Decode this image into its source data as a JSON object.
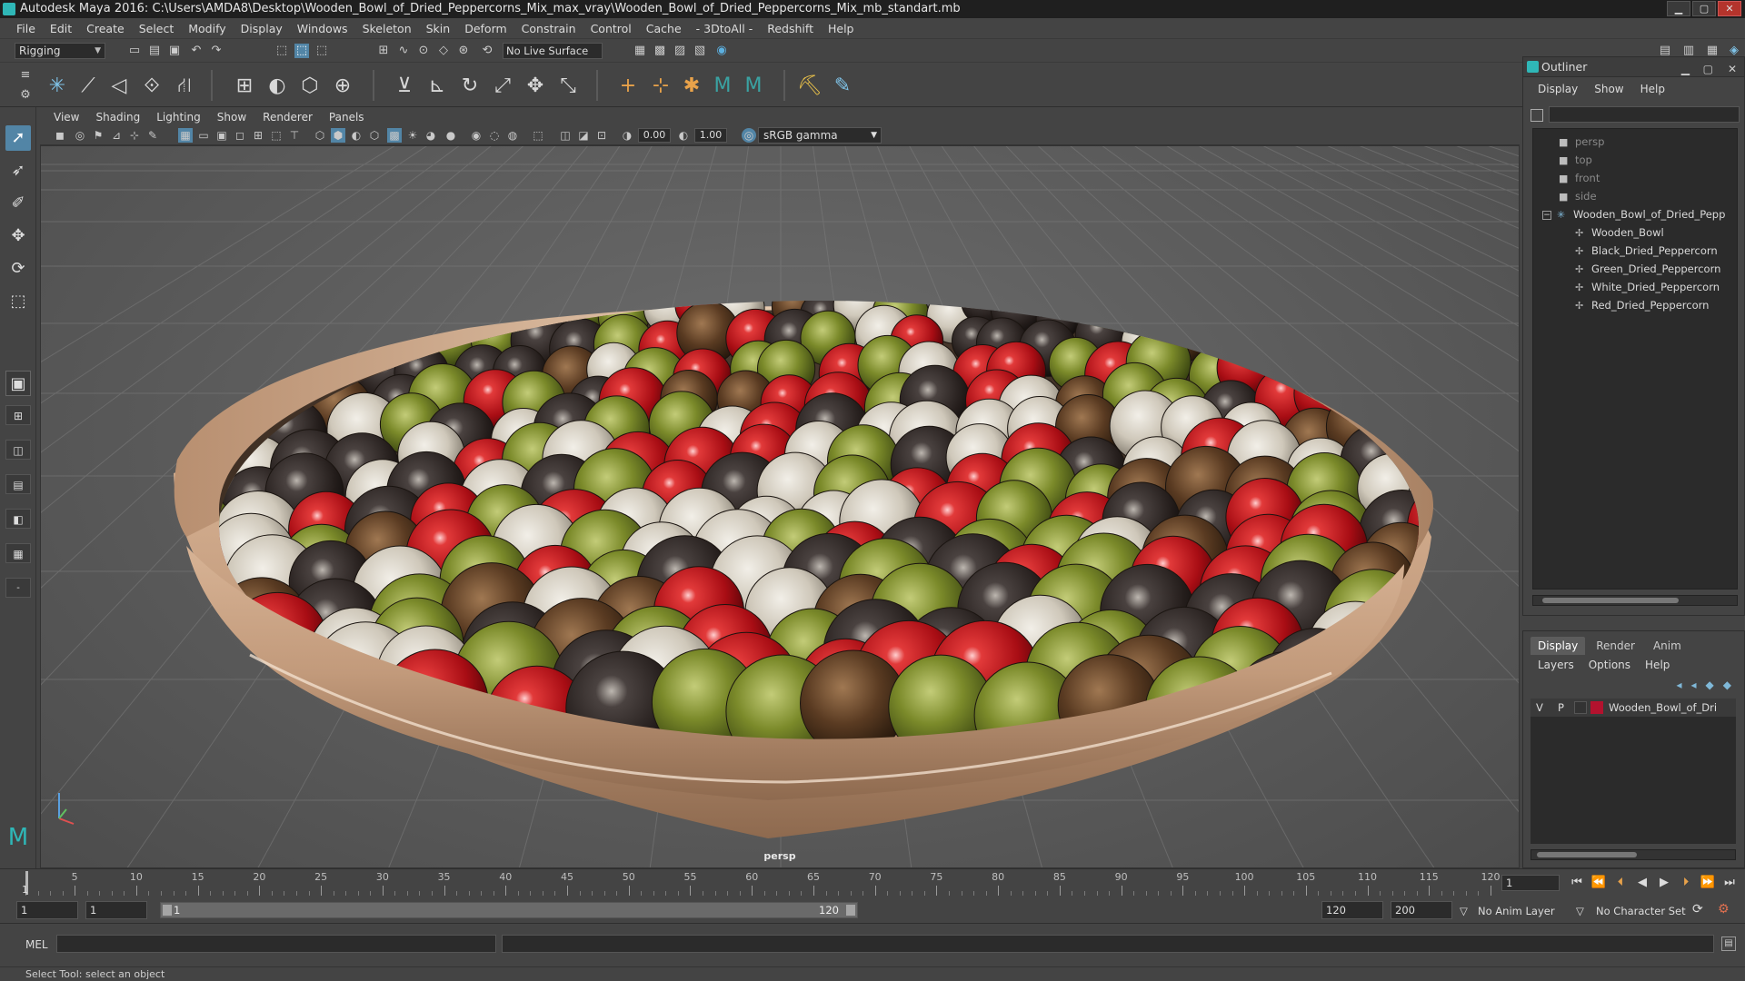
{
  "window": {
    "title": "Autodesk Maya 2016: C:\\Users\\AMDA8\\Desktop\\Wooden_Bowl_of_Dried_Peppercorns_Mix_max_vray\\Wooden_Bowl_of_Dried_Peppercorns_Mix_mb_standart.mb",
    "minimize": "▁",
    "maximize": "▢",
    "close": "✕"
  },
  "menubar": [
    "File",
    "Edit",
    "Create",
    "Select",
    "Modify",
    "Display",
    "Windows",
    "Skeleton",
    "Skin",
    "Deform",
    "Constrain",
    "Control",
    "Cache",
    "- 3DtoAll -",
    "Redshift",
    "Help"
  ],
  "statusline": {
    "mode": "Rigging",
    "live_surface": "No Live Surface"
  },
  "viewport": {
    "menus": [
      "View",
      "Shading",
      "Lighting",
      "Show",
      "Renderer",
      "Panels"
    ],
    "exposure": "0.00",
    "gamma": "1.00",
    "color_space": "sRGB gamma",
    "camera_label": "persp"
  },
  "outliner": {
    "title": "Outliner",
    "menus": [
      "Display",
      "Show",
      "Help"
    ],
    "items": [
      {
        "label": "persp",
        "type": "camera",
        "indent": 1,
        "dim": true
      },
      {
        "label": "top",
        "type": "camera",
        "indent": 1,
        "dim": true
      },
      {
        "label": "front",
        "type": "camera",
        "indent": 1,
        "dim": true
      },
      {
        "label": "side",
        "type": "camera",
        "indent": 1,
        "dim": true
      },
      {
        "label": "Wooden_Bowl_of_Dried_Pepp",
        "type": "group",
        "indent": 0,
        "expanded": true
      },
      {
        "label": "Wooden_Bowl",
        "type": "mesh",
        "indent": 2
      },
      {
        "label": "Black_Dried_Peppercorn",
        "type": "mesh",
        "indent": 2
      },
      {
        "label": "Green_Dried_Peppercorn",
        "type": "mesh",
        "indent": 2
      },
      {
        "label": "White_Dried_Peppercorn",
        "type": "mesh",
        "indent": 2
      },
      {
        "label": "Red_Dried_Peppercorn",
        "type": "mesh",
        "indent": 2
      }
    ]
  },
  "layers": {
    "tabs": [
      "Display",
      "Render",
      "Anim"
    ],
    "active_tab": "Display",
    "menus": [
      "Layers",
      "Options",
      "Help"
    ],
    "rows": [
      {
        "v": "V",
        "p": "P",
        "color": "#b3122e",
        "name": "Wooden_Bowl_of_Dri"
      }
    ]
  },
  "timeslider": {
    "ticks": [
      5,
      10,
      15,
      20,
      25,
      30,
      35,
      40,
      45,
      50,
      55,
      60,
      65,
      70,
      75,
      80,
      85,
      90,
      95,
      100,
      105,
      110,
      115,
      120
    ],
    "start": 1,
    "end": 120,
    "current": "1",
    "current_field": "1"
  },
  "range": {
    "start": "1",
    "inner_start": "1",
    "bar_start": "1",
    "bar_end": "120",
    "end": "120",
    "max_end": "200",
    "anim_layer": "No Anim Layer",
    "character_set": "No Character Set"
  },
  "cmdline": {
    "label": "MEL"
  },
  "helpline": {
    "text": "Select Tool: select an object"
  }
}
